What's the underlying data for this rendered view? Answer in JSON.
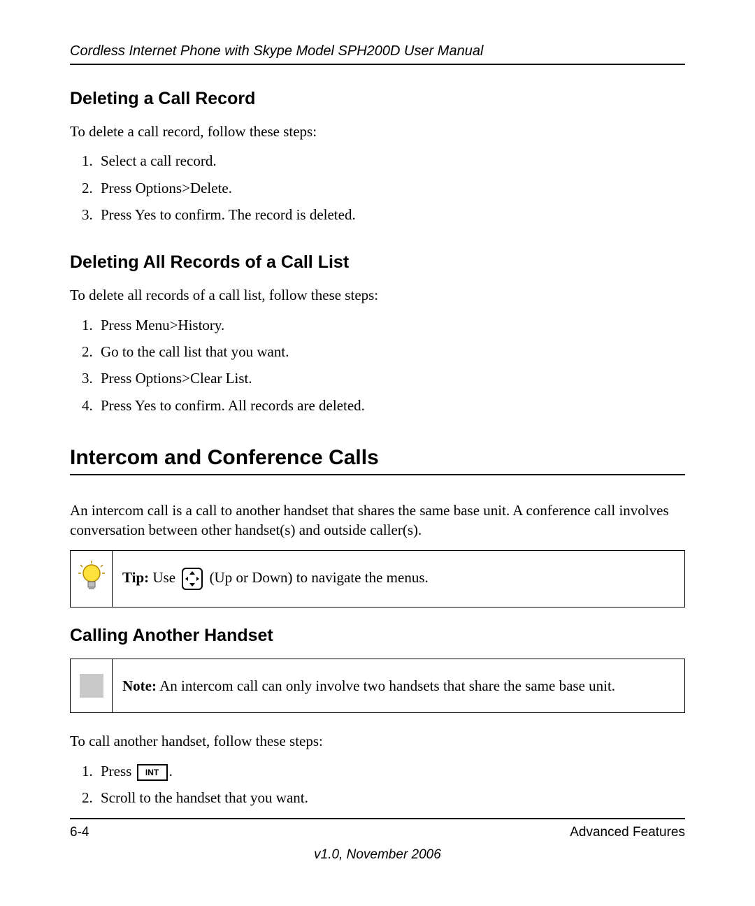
{
  "header": {
    "running_head": "Cordless Internet Phone with Skype Model SPH200D User Manual"
  },
  "sections": {
    "s1": {
      "heading": "Deleting a Call Record",
      "intro": "To delete a call record, follow these steps:",
      "steps": [
        "Select a call record.",
        "Press Options>Delete.",
        "Press Yes to confirm. The record is deleted."
      ]
    },
    "s2": {
      "heading": "Deleting All Records of a Call List",
      "intro": "To delete all records of a call list, follow these steps:",
      "steps": [
        "Press Menu>History.",
        "Go to the call list that you want.",
        "Press Options>Clear List.",
        "Press Yes to confirm. All records are deleted."
      ]
    },
    "s3": {
      "heading": "Intercom and Conference Calls",
      "para": "An intercom call is a call to another handset that shares the same base unit. A conference call involves conversation between other handset(s) and outside caller(s)."
    },
    "tip": {
      "label": "Tip:",
      "before": " Use ",
      "icon_name": "nav-updown-key",
      "after": " (Up or Down) to navigate the menus."
    },
    "s4": {
      "heading": "Calling Another Handset"
    },
    "note": {
      "label": "Note:",
      "text": " An intercom call can only involve two handsets that share the same base unit."
    },
    "s5": {
      "intro": "To call another handset, follow these steps:",
      "step1_prefix": "Press ",
      "step1_key_label": "INT",
      "step1_suffix": ".",
      "step2": "Scroll to the handset that you want."
    }
  },
  "footer": {
    "page_num": "6-4",
    "section_name": "Advanced Features",
    "version_line": "v1.0, November 2006"
  }
}
